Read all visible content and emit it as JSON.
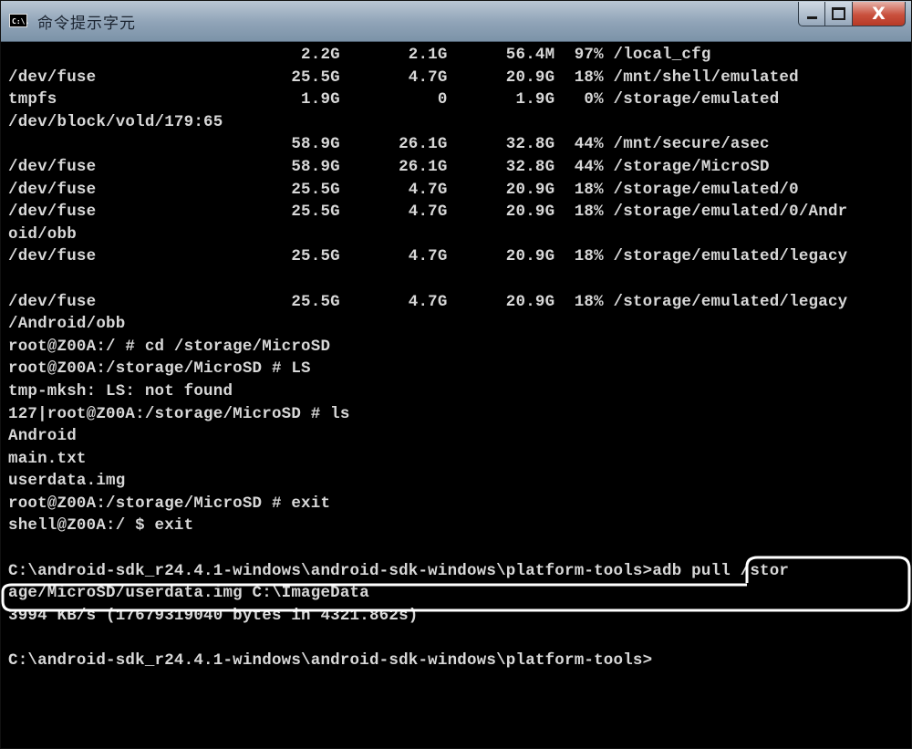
{
  "window": {
    "title": "命令提示字元",
    "icon": "cmd-icon",
    "icon_text": "C:\\.",
    "controls": {
      "minimize": "minimize-icon",
      "maximize": "maximize-icon",
      "close": "close-icon",
      "close_glyph": "X"
    }
  },
  "console": {
    "lines": [
      "                              2.2G       2.1G      56.4M  97% /local_cfg",
      "/dev/fuse                    25.5G       4.7G      20.9G  18% /mnt/shell/emulated",
      "tmpfs                         1.9G          0       1.9G   0% /storage/emulated",
      "/dev/block/vold/179:65",
      "                             58.9G      26.1G      32.8G  44% /mnt/secure/asec",
      "/dev/fuse                    58.9G      26.1G      32.8G  44% /storage/MicroSD",
      "/dev/fuse                    25.5G       4.7G      20.9G  18% /storage/emulated/0",
      "/dev/fuse                    25.5G       4.7G      20.9G  18% /storage/emulated/0/Andr",
      "oid/obb",
      "/dev/fuse                    25.5G       4.7G      20.9G  18% /storage/emulated/legacy",
      "",
      "/dev/fuse                    25.5G       4.7G      20.9G  18% /storage/emulated/legacy",
      "/Android/obb",
      "root@Z00A:/ # cd /storage/MicroSD",
      "root@Z00A:/storage/MicroSD # LS",
      "tmp-mksh: LS: not found",
      "127|root@Z00A:/storage/MicroSD # ls",
      "Android",
      "main.txt",
      "userdata.img",
      "root@Z00A:/storage/MicroSD # exit",
      "shell@Z00A:/ $ exit",
      "",
      "C:\\android-sdk_r24.4.1-windows\\android-sdk-windows\\platform-tools>adb pull /stor",
      "age/MicroSD/userdata.img C:\\ImageData",
      "3994 KB/s (17679319040 bytes in 4321.862s)",
      "",
      "C:\\android-sdk_r24.4.1-windows\\android-sdk-windows\\platform-tools>"
    ]
  },
  "highlight_color": "#ffffff"
}
